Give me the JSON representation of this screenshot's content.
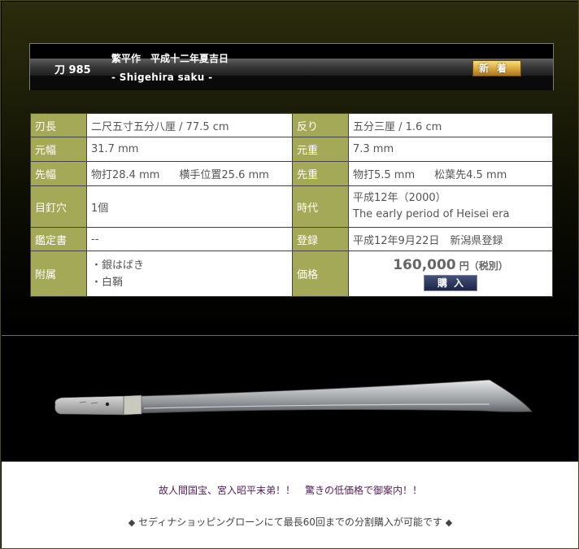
{
  "header": {
    "sword_number": "刀 985",
    "title_jp": "繁平作　平成十二年夏吉日",
    "title_en": "- Shigehira saku -",
    "new_badge": "新着"
  },
  "specs": {
    "hacho_label": "刃長",
    "hacho_value": "二尺五寸五分八厘 / 77.5 cm",
    "sori_label": "反り",
    "sori_value": "五分三厘 / 1.6 cm",
    "motohaba_label": "元幅",
    "motohaba_value": "31.7 mm",
    "motogasane_label": "元重",
    "motogasane_value": "7.3 mm",
    "sakihaba_label": "先幅",
    "sakihaba_value_a": "物打28.4 mm",
    "sakihaba_value_b": "横手位置25.6 mm",
    "sakigasane_label": "先重",
    "sakigasane_value_a": "物打5.5 mm",
    "sakigasane_value_b": "松葉先4.5 mm",
    "mekugiana_label": "目釘穴",
    "mekugiana_value": "1個",
    "jidai_label": "時代",
    "jidai_value_jp": "平成12年（2000）",
    "jidai_value_en": "The early period of Heisei era",
    "kanteisho_label": "鑑定書",
    "kanteisho_value": "--",
    "toroku_label": "登録",
    "toroku_value": "平成12年9月22日　新潟県登録",
    "fuzoku_label": "附属",
    "fuzoku_items": [
      "・銀はばき",
      "・白鞘"
    ],
    "kakaku_label": "価格",
    "price": "160,000",
    "price_unit": "円（税別）",
    "buy_label": "購入"
  },
  "footer": {
    "notice1": "故人間国宝、宮入昭平末弟！！　驚きの低価格で御案内！！",
    "notice2": "セディナショッピングローンにて最長60回までの分割購入が可能です",
    "diamond": "◆"
  },
  "colors": {
    "label_bg": "#a4a957",
    "notice_purple": "#571d5a",
    "buy_button": "#2a3458"
  }
}
